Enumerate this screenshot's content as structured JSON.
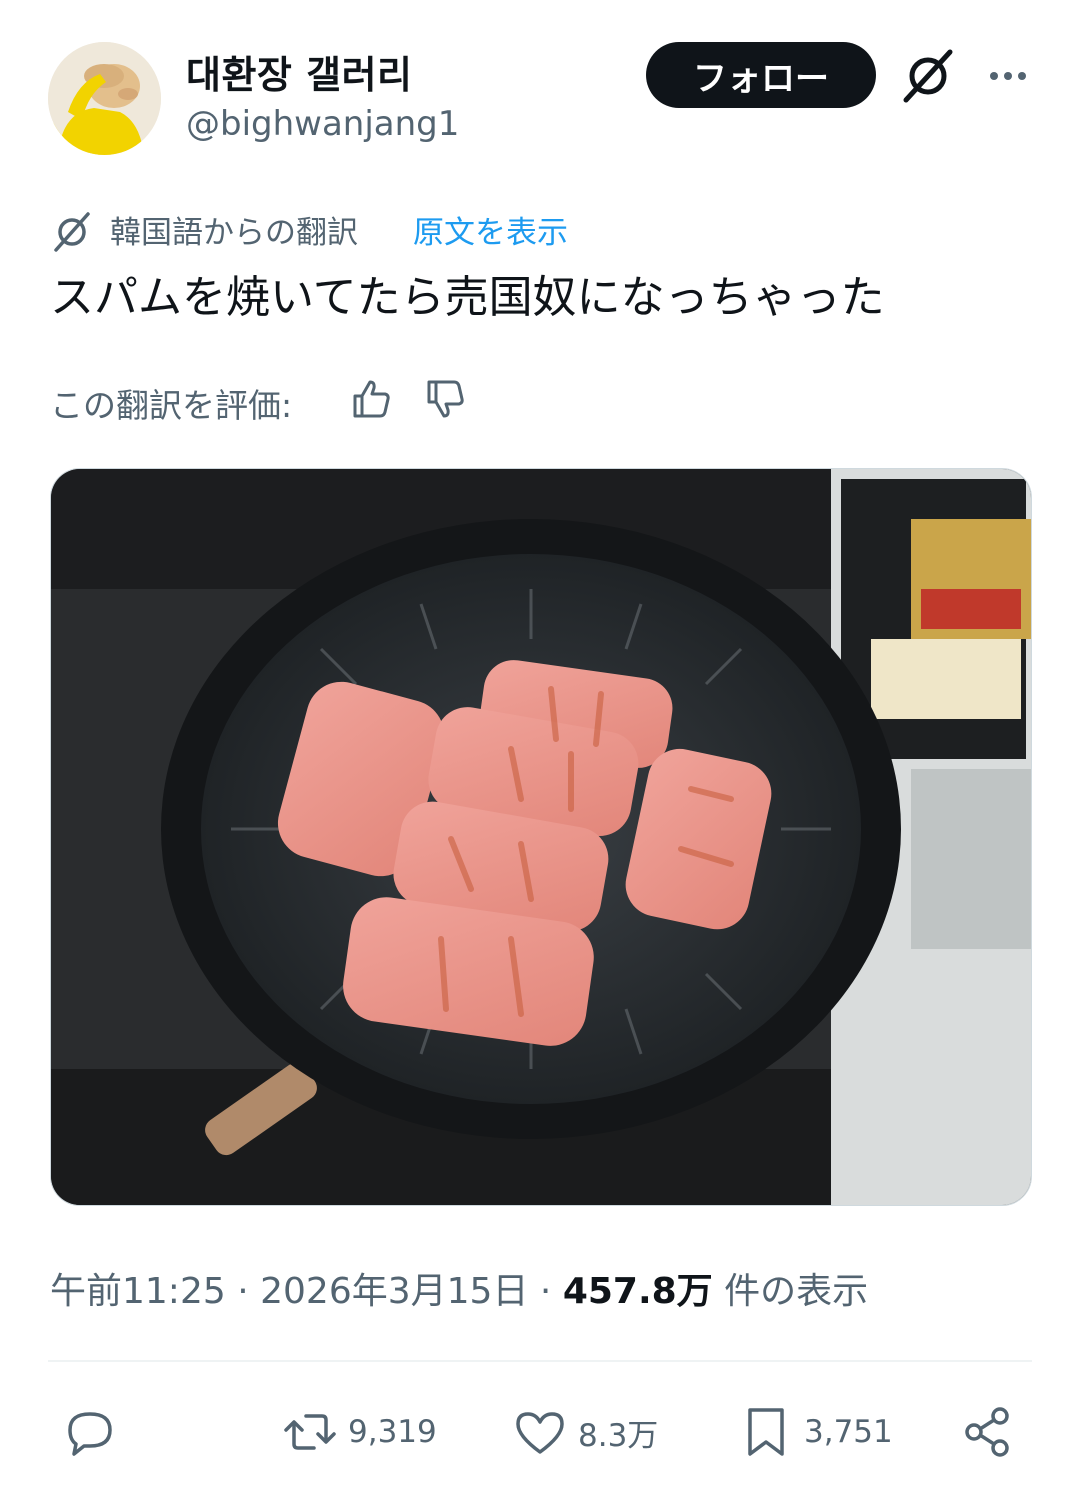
{
  "author": {
    "display_name": "대환장 갤러리",
    "handle": "@bighwanjang1"
  },
  "follow_label": "フォロー",
  "translation": {
    "translated_from": "韓国語からの翻訳",
    "show_original": "原文を表示"
  },
  "tweet": {
    "text": "スパムを焼いてたら売国奴になっちゃった"
  },
  "rate": {
    "label": "この翻訳を評価:"
  },
  "meta": {
    "time": "午前11:25",
    "separator": "·",
    "date": "2026年3月15日",
    "views_value": "457.8万",
    "views_suffix": "件の表示"
  },
  "actions": {
    "retweets": "9,319",
    "likes": "8.3万",
    "bookmarks": "3,751"
  },
  "colors": {
    "text_primary": "#0f1419",
    "text_secondary": "#536471",
    "link": "#1d9bf0",
    "divider": "#eff3f4"
  },
  "icons": {
    "grok": "grok-icon",
    "more": "more-icon",
    "translate": "translate-icon",
    "thumb_up": "thumb-up-icon",
    "thumb_down": "thumb-down-icon",
    "reply": "reply-icon",
    "retweet": "retweet-icon",
    "like": "heart-icon",
    "bookmark": "bookmark-icon",
    "share": "share-icon"
  }
}
